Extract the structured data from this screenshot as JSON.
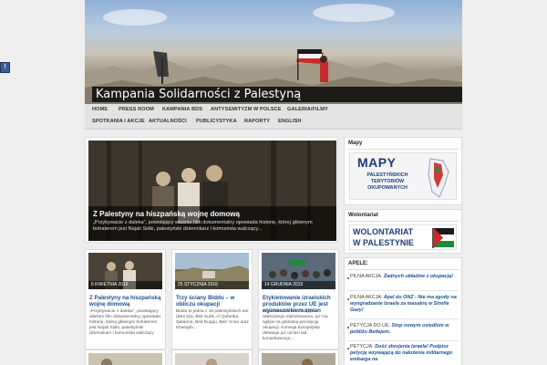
{
  "site": {
    "title": "Kampania Solidarności z Palestyną",
    "side_tab_glyph": "f"
  },
  "nav": {
    "row1": [
      "HOME",
      "PRESS ROOM",
      "KAMPANIA BDS",
      "ANTYSEMITYZM W POLSCE",
      "GALERIA/FILMY"
    ],
    "row2": [
      "SPOTKANIA I AKCJE",
      "AKTUALNOŚCI",
      "PUBLICYSTYKA",
      "RAPORTY",
      "ENGLISH"
    ]
  },
  "featured": {
    "title": "Z Palestyny na hiszpańską wojnę domową",
    "excerpt": "„Przybywacie z daleka”, powstający właśnie film dokumentalny opowiada historię, której głównym bohaterem jest Najati Sidki, palestyński dziennikarz i komunista walczący..."
  },
  "cards": [
    {
      "date": "6 KWIETNIA 2016",
      "title": "Z Palestyny na hiszpańską wojnę domową",
      "excerpt": "„Przybywacie z daleka”, powstający właśnie film dokumentalny opowiada historię, której głównym bohaterem jest Najati Sidki, palestyński dziennikarz i komunista walczący"
    },
    {
      "date": "25 STYCZNIA 2016",
      "title": "Trzy ściany Biddu – w obliczu okupacji",
      "excerpt": "Biddu to jedna z 10 palestyńskich wsi (Beit Ijza, Beit Surik, Al Qubeiba, Qatanna, Beit Duqqu, Beit 'Anan oraz Kharayib..."
    },
    {
      "date": "14 GRUDNIA 2015",
      "title": "Etykietowanie izraelskich produktów przez UE jest wyznacznikiem zmian",
      "excerpt": "Etykietowanie UE żadające właściwego etykietowania, już ma wpływ na globalną percepcję okupacji. Komisja Europejska debatuje już od lat nad konsekwencja..."
    }
  ],
  "sidebar": {
    "mapy": {
      "title": "Mapy",
      "ad_title": "MAPY",
      "ad_sub": "PALESTYŃSKICH TERYTORIÓW OKUPOWANYCH"
    },
    "wolontariat": {
      "title": "Wolontariat",
      "ad_title": "WOLONTARIAT",
      "ad_sub": "W PALESTYNIE"
    },
    "apele": {
      "title": "APELE:",
      "items": [
        {
          "lead": "PILNA AKCJA:",
          "link": "Żadnych układów z okupacją!"
        },
        {
          "lead": "PILNA AKCJA:",
          "link": "Apel do ONZ - Nie ma zgody na wyngradzanie Izraela za masakrę w Strefie Gazy!"
        },
        {
          "lead": "PETYCJA DO UE:",
          "link": "Stop nowym osiedlom w pobliżu Betlejem."
        },
        {
          "lead": "PETYCJA:",
          "link": "Dość zbrojenia Izraela! Podpisz petycję wzywającą do nałożenia militarnego embarga na"
        }
      ]
    }
  },
  "colors": {
    "link": "#1c4f94",
    "nav_bg": "#e3e3e3",
    "page_bg": "#eeeeee",
    "title_bar": "#000000"
  }
}
